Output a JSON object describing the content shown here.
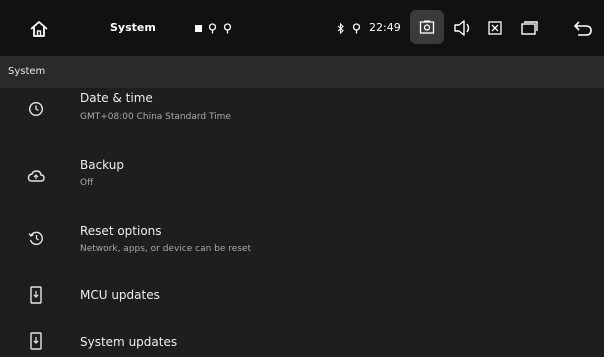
{
  "status_bar": {
    "title": "System",
    "time": "22:49",
    "icons": {
      "home": "home-icon",
      "notification": [
        "notification-square-icon",
        "location-pin-icon",
        "location-pin-icon"
      ],
      "bluetooth": "bluetooth-icon",
      "gps": "location-pin-icon",
      "screenshot": "camera-icon",
      "volume": "volume-icon",
      "close_app": "close-box-icon",
      "recents": "recents-icon",
      "back": "back-icon"
    }
  },
  "section_header": {
    "label": "System"
  },
  "items": [
    {
      "title": "Date & time",
      "subtitle": "GMT+08:00 China Standard Time",
      "icon": "clock-icon"
    },
    {
      "title": "Backup",
      "subtitle": "Off",
      "icon": "cloud-backup-icon"
    },
    {
      "title": "Reset options",
      "subtitle": "Network, apps, or device can be reset",
      "icon": "history-icon"
    },
    {
      "title": "MCU updates",
      "subtitle": "",
      "icon": "phone-update-icon"
    },
    {
      "title": "System updates",
      "subtitle": "",
      "icon": "phone-update-icon"
    }
  ]
}
